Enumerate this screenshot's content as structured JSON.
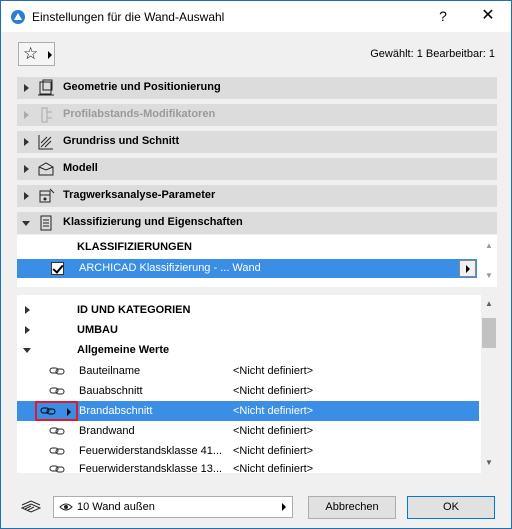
{
  "window": {
    "title": "Einstellungen für die Wand-Auswahl",
    "help_label": "?",
    "close_label": "✕"
  },
  "toolbar": {
    "favorites_icon": "star-icon",
    "selection_info": "Gewählt: 1 Bearbeitbar: 1"
  },
  "sections": [
    {
      "label": "Geometrie und Positionierung",
      "icon": "geometry-icon",
      "expanded": false,
      "enabled": true
    },
    {
      "label": "Profilabstands-Modifikatoren",
      "icon": "profile-offset-icon",
      "expanded": false,
      "enabled": false
    },
    {
      "label": "Grundriss und Schnitt",
      "icon": "floorplan-section-icon",
      "expanded": false,
      "enabled": true
    },
    {
      "label": "Modell",
      "icon": "model-icon",
      "expanded": false,
      "enabled": true
    },
    {
      "label": "Tragwerksanalyse-Parameter",
      "icon": "structural-analysis-icon",
      "expanded": false,
      "enabled": true
    },
    {
      "label": "Klassifizierung und Eigenschaften",
      "icon": "classification-icon",
      "expanded": true,
      "enabled": true
    }
  ],
  "classifications": {
    "header": "KLASSIFIZIERUNGEN",
    "row_label": "ARCHICAD Klassifizierung - ... Wand",
    "checked": true
  },
  "properties": {
    "groups": [
      {
        "label": "ID UND KATEGORIEN",
        "expanded": false
      },
      {
        "label": "UMBAU",
        "expanded": false
      },
      {
        "label": "Allgemeine Werte",
        "expanded": true
      }
    ],
    "rows": [
      {
        "name": "Bauteilname",
        "value": "<Nicht definiert>",
        "selected": false
      },
      {
        "name": "Bauabschnitt",
        "value": "<Nicht definiert>",
        "selected": false
      },
      {
        "name": "Brandabschnitt",
        "value": "<Nicht definiert>",
        "selected": true
      },
      {
        "name": "Brandwand",
        "value": "<Nicht definiert>",
        "selected": false
      },
      {
        "name": "Feuerwiderstandsklasse 41...",
        "value": "<Nicht definiert>",
        "selected": false
      },
      {
        "name": "Feuerwiderstandsklasse 13...",
        "value": "<Nicht definiert>",
        "selected": false
      }
    ]
  },
  "footer": {
    "layer_label": "10 Wand außen",
    "cancel_label": "Abbrechen",
    "ok_label": "OK"
  },
  "colors": {
    "selection": "#3a8ee6",
    "highlight_box": "#e0192e",
    "section_bg": "#dcdcdc"
  }
}
